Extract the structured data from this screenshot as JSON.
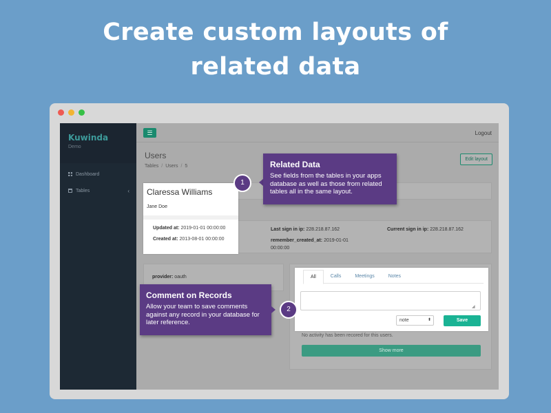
{
  "headline": {
    "line1": "Create custom layouts of",
    "line2": "related data"
  },
  "app": {
    "brand": "Kuwinda",
    "brand_sub": "Demo",
    "nav": [
      {
        "label": "Dashboard",
        "icon": "dashboard-icon"
      },
      {
        "label": "Tables",
        "icon": "table-icon",
        "caret": "‹"
      }
    ],
    "menu_icon": "☰",
    "logout": "Logout",
    "page_title": "Users",
    "breadcrumb": [
      "Tables",
      "Users",
      "5"
    ],
    "breadcrumb_sep": "/",
    "edit_layout": "Edit layout",
    "profile": {
      "name": "Claressa Williams",
      "subtitle": "Jane Doe",
      "updated_label": "Updated at:",
      "updated_value": "2019-01-01 00:00:00",
      "created_label": "Created at:",
      "created_value": "2013-08-01 00:00:00"
    },
    "meta": {
      "last_sign_in_label": "Last sign in ip:",
      "last_sign_in_value": "228.218.87.162",
      "current_sign_in_label": "Current sign in ip:",
      "current_sign_in_value": "228.218.87.162",
      "remember_label": "remember_created_at:",
      "remember_value_1": "2019-01-01",
      "remember_value_2": "00:00:00",
      "provider_label": "provider:",
      "provider_value": "oauth"
    },
    "comments": {
      "tabs": [
        "All",
        "Calls",
        "Meetings",
        "Notes"
      ],
      "active_tab": "All",
      "comment_value": "",
      "type_select": "note",
      "select_arrow": "⬍",
      "resize_glyph": "◢",
      "save": "Save",
      "no_activity": "No activity has been recored for this users.",
      "show_more": "Show more"
    }
  },
  "callouts": [
    {
      "number": "1",
      "title": "Related Data",
      "body": "See fields from the tables in your apps database as well as those from related tables all in the same layout."
    },
    {
      "number": "2",
      "title": "Comment on Records",
      "body": "Allow your team to save comments against any record in your database for later reference."
    }
  ],
  "colors": {
    "background": "#6b9ec9",
    "callout": "#5b3b84",
    "accent": "#1ab394",
    "sidebar": "#1d2934"
  }
}
